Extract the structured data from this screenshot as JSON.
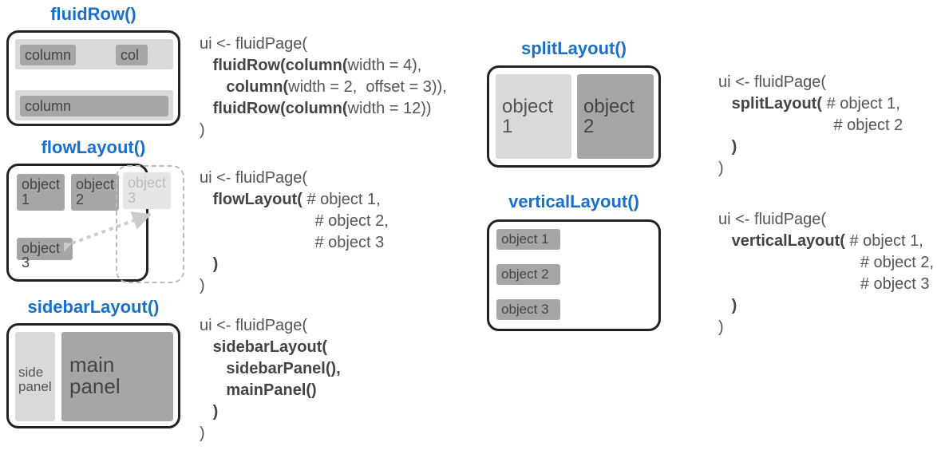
{
  "fluidRow": {
    "title": "fluidRow()",
    "labels": {
      "column1": "column",
      "col2": "col",
      "column3": "column"
    },
    "code": {
      "l1": "ui <- fluidPage(",
      "l2a": "fluidRow(column(",
      "l2b": "width = 4),",
      "l3a": "column(",
      "l3b": "width = 2,  offset = 3)),",
      "l4a": "fluidRow(column(",
      "l4b": "width = 12))",
      "l5": ")"
    }
  },
  "flowLayout": {
    "title": "flowLayout()",
    "labels": {
      "o1": "object 1",
      "o2": "object 2",
      "o3g": "object 3",
      "o3": "object 3"
    },
    "code": {
      "l1": "ui <- fluidPage(",
      "l2a": "flowLayout( ",
      "l2b": "# object 1,",
      "l3": "# object 2,",
      "l4": "# object 3",
      "l5": ")",
      "l6": ")"
    }
  },
  "sidebarLayout": {
    "title": "sidebarLayout()",
    "labels": {
      "side1": "side",
      "side2": "panel",
      "main1": "main",
      "main2": "panel"
    },
    "code": {
      "l1": "ui <- fluidPage(",
      "l2": "sidebarLayout(",
      "l3": "sidebarPanel(),",
      "l4": "mainPanel()",
      "l5": ")",
      "l6": ")"
    }
  },
  "splitLayout": {
    "title": "splitLayout()",
    "labels": {
      "o1a": "object",
      "o1b": "1",
      "o2a": "object",
      "o2b": "2"
    },
    "code": {
      "l1": "ui <- fluidPage(",
      "l2a": "splitLayout( ",
      "l2b": "# object 1,",
      "l3": "# object 2",
      "l4": ")",
      "l5": ")"
    }
  },
  "verticalLayout": {
    "title": "verticalLayout()",
    "labels": {
      "o1": "object 1",
      "o2": "object 2",
      "o3": "object 3"
    },
    "code": {
      "l1": "ui <- fluidPage(",
      "l2a": "verticalLayout( ",
      "l2b": "# object 1,",
      "l3": "# object 2,",
      "l4": "# object 3",
      "l5": ")",
      "l6": ")"
    }
  }
}
